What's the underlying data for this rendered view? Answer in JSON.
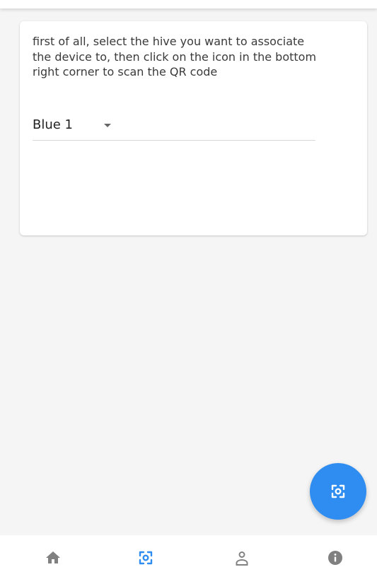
{
  "instructions": {
    "text": "first of all, select the hive you want to associate the device to, then click on the icon in the bottom right corner to scan the QR code"
  },
  "hive_select": {
    "selected": "Blue 1"
  },
  "fab": {
    "icon": "qr-scan-icon"
  },
  "bottom_nav": {
    "items": [
      {
        "icon": "home-icon",
        "active": false
      },
      {
        "icon": "qr-scan-icon",
        "active": true
      },
      {
        "icon": "person-icon",
        "active": false
      },
      {
        "icon": "info-icon",
        "active": false
      }
    ]
  },
  "colors": {
    "accent": "#2f8cf0",
    "background": "#f5f5f5",
    "card": "#ffffff",
    "inactive_icon": "#808080"
  }
}
